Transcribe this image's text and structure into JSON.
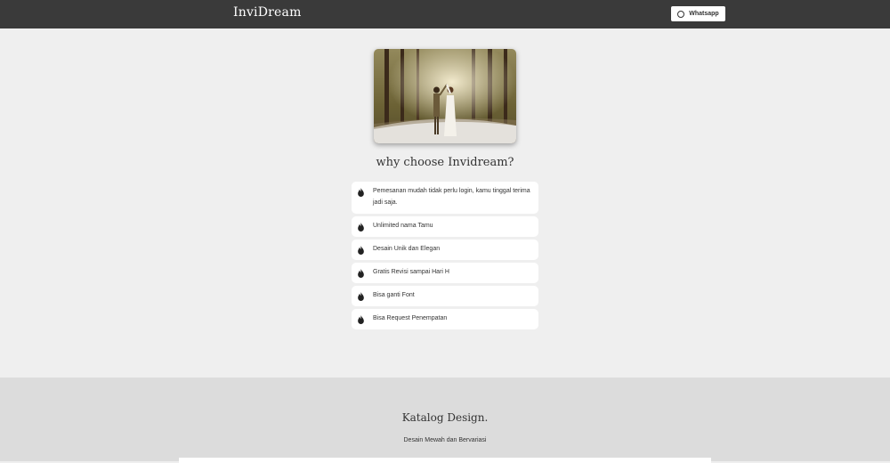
{
  "header": {
    "logo": "InviDream",
    "whatsapp_label": "Whatsapp",
    "whatsapp_icon": "whatsapp-icon"
  },
  "why": {
    "title": "why choose Invidream?",
    "item_icon": "flame-icon",
    "items": [
      {
        "label": "Pemesanan mudah tidak perlu login, kamu tinggal terima jadi saja."
      },
      {
        "label": "Unlimited nama Tamu"
      },
      {
        "label": "Desain Unik dan Elegan"
      },
      {
        "label": "Gratis Revisi sampai Hari H"
      },
      {
        "label": "Bisa ganti Font"
      },
      {
        "label": "Bisa Request Penempatan"
      }
    ]
  },
  "catalog": {
    "title": "Katalog Design.",
    "subtitle": "Desain Mewah dan Bervariasi"
  },
  "colors": {
    "navbar": "#3a3a3a",
    "page_bg": "#efefef",
    "catalog_bg": "#dcdcdc"
  }
}
